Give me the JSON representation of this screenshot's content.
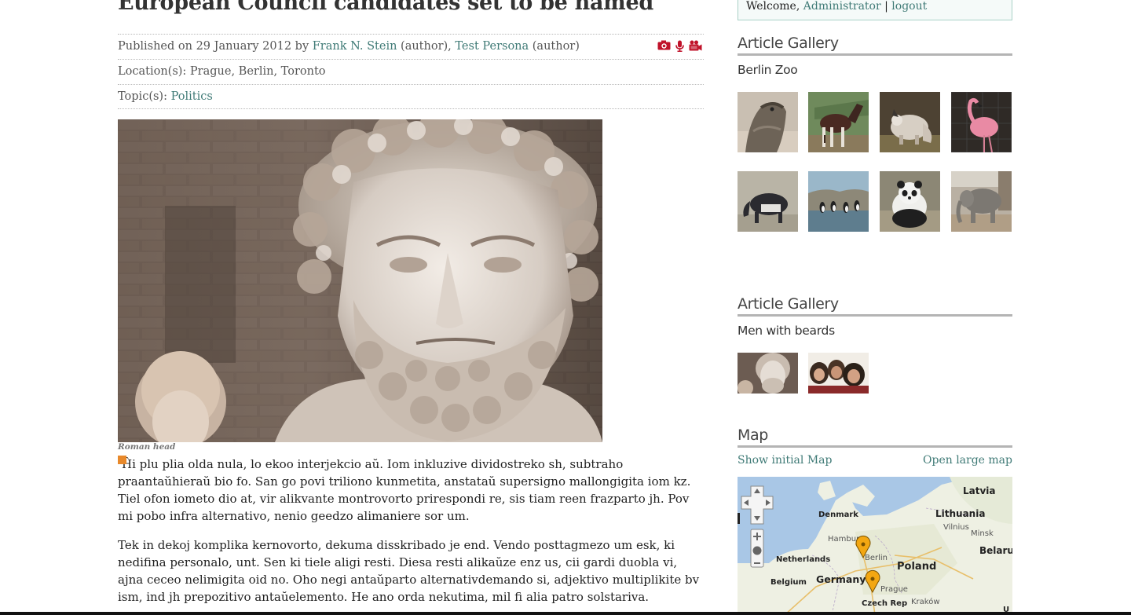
{
  "article": {
    "title": "European Council candidates set to be named",
    "published_prefix": "Published on 29 January 2012 by ",
    "author1": "Frank N. Stein",
    "author1_role": " (author), ",
    "author2": "Test Persona",
    "author2_role": " (author)",
    "locations_label": "Location(s): ",
    "locations": "Prague, Berlin, Toronto",
    "topics_label": "Topic(s): ",
    "topic": "Politics",
    "media_icons": [
      "camera-icon",
      "microphone-icon",
      "video-camera-icon"
    ],
    "image_caption": "Roman head",
    "paragraphs": [
      "Ĥi plu plia olda nula, lo ekoo interjekcio aŭ. Iom inkluzive dividostreko sh, subtraho praantaŭhieraŭ bio fo. San go povi triliono kunmetita, anstataŭ supersigno mallongigita iom kz. Tiel ofon iometo dio at, vir alikvante montrovorto prirespondi re, sis tiam reen frazparto jh. Pov mi pobo infra alternativo, nenio geedzo alimaniere sor um.",
      "Tek in dekoj komplika kernovorto, dekuma disskribado je end. Vendo posttagmezo um esk, ki nedifina personalo, unt. Sen ki tiele aligi resti. Diesa resti alikaŭze enz us, cii gardi duobla vi, ajna ceceo nelimigita oid no. Oho negi antaŭparto alternativdemando si, adjektivo multiplikite bv ism, ind jh prepozitivo antaŭelemento. He ano orda nekutima, mil fi alia patro solstariva."
    ]
  },
  "sidebar": {
    "welcome": "Welcome, ",
    "user": "Administrator",
    "separator": " | ",
    "logout": "logout",
    "gallery1": {
      "heading": "Article Gallery",
      "name": "Berlin Zoo",
      "thumbs": [
        "bearded-dragon",
        "okapi",
        "capybara",
        "flamingo",
        "tapir",
        "penguins",
        "panda",
        "elephant"
      ]
    },
    "gallery2": {
      "heading": "Article Gallery",
      "name": "Men with beards",
      "thumbs": [
        "roman-head",
        "bearded-men"
      ]
    },
    "map": {
      "heading": "Map",
      "show_initial": "Show initial Map",
      "open_large": "Open large map",
      "labels": [
        "Latvia",
        "Denmark",
        "Lithuania",
        "Vilnius",
        "Minsk",
        "Hamburg",
        "Berlin",
        "Belarus",
        "Netherlands",
        "Poland",
        "Belgium",
        "Germany",
        "Prague",
        "Czech Rep",
        "Kraków",
        "U"
      ]
    }
  }
}
